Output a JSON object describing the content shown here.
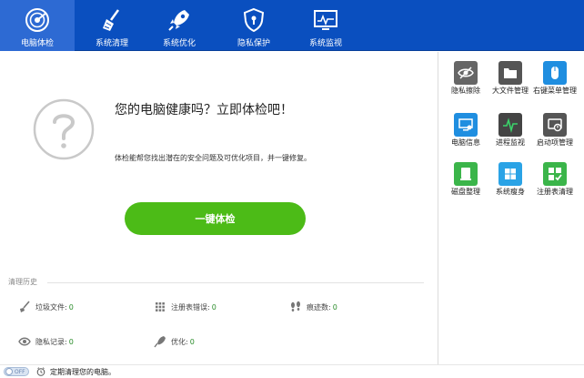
{
  "nav": {
    "items": [
      {
        "label": "电脑体检",
        "icon": "radar-icon",
        "active": true
      },
      {
        "label": "系统清理",
        "icon": "broom-icon",
        "active": false
      },
      {
        "label": "系统优化",
        "icon": "rocket-icon",
        "active": false
      },
      {
        "label": "隐私保护",
        "icon": "shield-icon",
        "active": false
      },
      {
        "label": "系统监视",
        "icon": "monitor-icon",
        "active": false
      }
    ]
  },
  "main": {
    "headline": "您的电脑健康吗？立即体检吧！",
    "subtext": "体检能帮您找出潜在的安全问题及可优化项目，并一键修复。",
    "check_button": "一键体检"
  },
  "history": {
    "title": "清理历史",
    "stats": [
      {
        "label": "垃圾文件:",
        "value": "0",
        "icon": "brush-icon"
      },
      {
        "label": "注册表错误:",
        "value": "0",
        "icon": "grid-icon"
      },
      {
        "label": "痕迹数:",
        "value": "0",
        "icon": "footprint-icon"
      },
      {
        "label": "隐私记录:",
        "value": "0",
        "icon": "eye-icon"
      },
      {
        "label": "优化:",
        "value": "0",
        "icon": "rocket-small-icon"
      }
    ]
  },
  "tools": [
    {
      "label": "隐私擦除",
      "icon": "privacy-erase-icon",
      "color": "#666666"
    },
    {
      "label": "大文件管理",
      "icon": "folder-icon",
      "color": "#555555"
    },
    {
      "label": "右键菜单管理",
      "icon": "mouse-icon",
      "color": "#1f8ee0"
    },
    {
      "label": "电脑信息",
      "icon": "pc-info-icon",
      "color": "#1f8ee0"
    },
    {
      "label": "进程监视",
      "icon": "pulse-icon",
      "color": "#444444"
    },
    {
      "label": "启动项管理",
      "icon": "startup-icon",
      "color": "#555555"
    },
    {
      "label": "磁盘整理",
      "icon": "disk-icon",
      "color": "#3bb54a"
    },
    {
      "label": "系统瘦身",
      "icon": "windows-icon",
      "color": "#2aa3e6"
    },
    {
      "label": "注册表清理",
      "icon": "registry-icon",
      "color": "#3bb54a"
    }
  ],
  "bottom": {
    "toggle_text": "OFF",
    "text": "定期清理您的电脑。"
  },
  "colors": {
    "nav_bg": "#0a4fbf",
    "nav_active": "#2d6ad3",
    "button_green": "#4cbb17",
    "value_green": "#2a8c2a"
  }
}
